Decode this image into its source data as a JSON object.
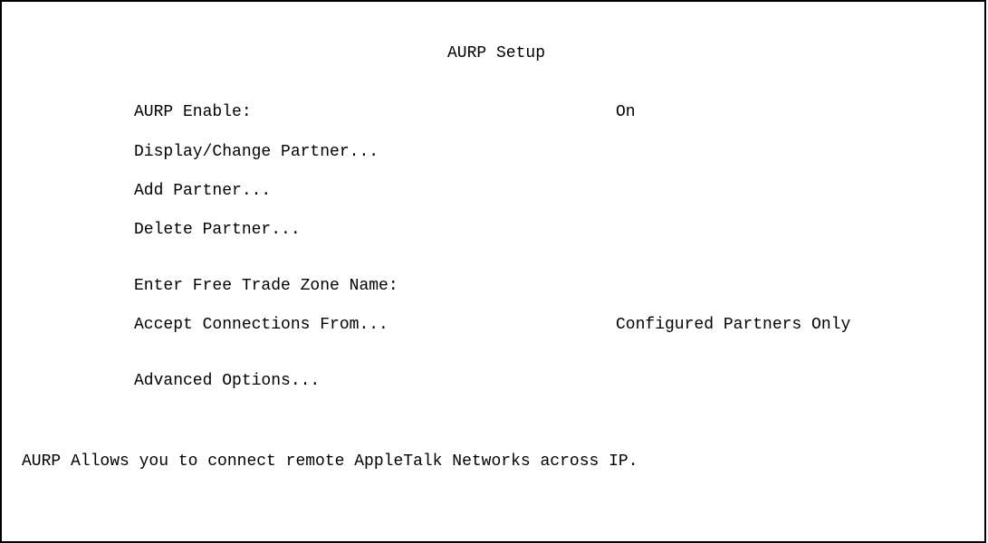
{
  "screen": {
    "title": "AURP Setup"
  },
  "menu": {
    "aurp_enable": {
      "label": "AURP Enable:",
      "value": "On"
    },
    "display_change_partner": "Display/Change Partner...",
    "add_partner": "Add Partner...",
    "delete_partner": "Delete Partner...",
    "free_trade_zone": {
      "label": "Enter Free Trade Zone Name:",
      "value": ""
    },
    "accept_connections": {
      "label": "Accept Connections From...",
      "value": "Configured Partners Only"
    },
    "advanced_options": "Advanced Options..."
  },
  "status_line": "AURP Allows you to connect remote AppleTalk Networks across IP."
}
